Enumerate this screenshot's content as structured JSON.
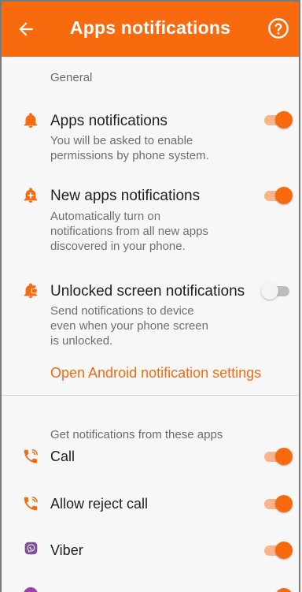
{
  "header": {
    "title": "Apps notifications",
    "back_icon": "arrow-left-icon",
    "help_icon": "help-circle-icon",
    "color": "#f76a0e"
  },
  "general": {
    "label": "General",
    "items": [
      {
        "title": "Apps notifications",
        "lines": [
          "You will be asked to enable",
          "permissions by phone system."
        ],
        "enabled": true,
        "icon": "bell-icon"
      },
      {
        "title": "New apps notifications",
        "lines": [
          "Automatically turn on",
          "notifications from all new apps",
          "discovered in your phone."
        ],
        "enabled": true,
        "icon": "new-bell-icon"
      },
      {
        "title": "Unlocked screen notifications",
        "lines": [
          "Send notifications to device",
          "even when your phone screen",
          "is unlocked."
        ],
        "enabled": false,
        "icon": "unlocked-bell-icon"
      }
    ],
    "link": "Open Android notification settings"
  },
  "apps": {
    "label": "Get notifications from these apps",
    "items": [
      {
        "label": "Call",
        "enabled": true,
        "icon": "phone-icon",
        "icon_color": "#f76a0e"
      },
      {
        "label": "Allow reject call",
        "enabled": true,
        "icon": "phone-reject-icon",
        "icon_color": "#f76a0e"
      },
      {
        "label": "Viber",
        "enabled": true,
        "icon": "viber-icon",
        "icon_color": "#7b519d"
      }
    ]
  }
}
